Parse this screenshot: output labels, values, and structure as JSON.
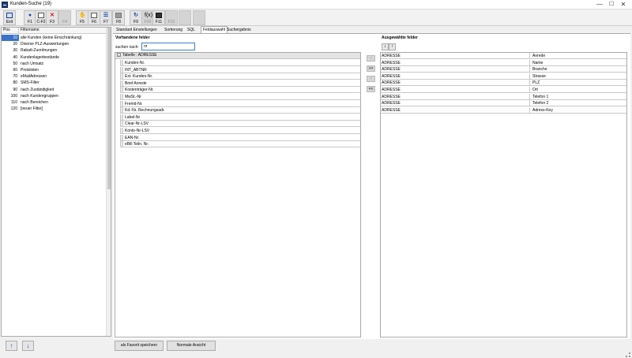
{
  "window": {
    "title": "Kunden-Suche (19)",
    "min_glyph": "—",
    "max_glyph": "☐",
    "close_glyph": "✕"
  },
  "toolbar": [
    {
      "label": "Exit",
      "icon": "exit-door-icon",
      "glyph": "",
      "style": "box",
      "enabled": true
    },
    {
      "label": "F1",
      "icon": "help-icon",
      "glyph": "●",
      "style": "blue",
      "enabled": true
    },
    {
      "label": "C-F2",
      "icon": "new-document-icon",
      "glyph": "",
      "style": "doc",
      "enabled": true
    },
    {
      "label": "F3",
      "icon": "delete-icon",
      "glyph": "✕",
      "style": "red",
      "enabled": true
    },
    {
      "label": "F4",
      "icon": "disabled-icon",
      "glyph": "",
      "style": "",
      "enabled": false
    },
    {
      "label": "F5",
      "icon": "hand-icon",
      "glyph": "✋",
      "style": "",
      "enabled": true
    },
    {
      "label": "F6",
      "icon": "copy-icon",
      "glyph": "",
      "style": "doc",
      "enabled": true
    },
    {
      "label": "F7",
      "icon": "list-icon",
      "glyph": "☰",
      "style": "blue",
      "enabled": true
    },
    {
      "label": "F8",
      "icon": "print-icon",
      "glyph": "",
      "style": "grey",
      "enabled": true
    },
    {
      "label": "F9",
      "icon": "refresh-icon",
      "glyph": "↻",
      "style": "blue",
      "enabled": true
    },
    {
      "label": "F10",
      "icon": "function-icon",
      "glyph": "f(x)",
      "style": "",
      "enabled": false
    },
    {
      "label": "F11",
      "icon": "film-icon",
      "glyph": "",
      "style": "dark",
      "enabled": true
    },
    {
      "label": "F12",
      "icon": "disabled-icon",
      "glyph": "",
      "style": "",
      "enabled": false
    },
    {
      "label": "",
      "icon": "blank-icon",
      "glyph": "",
      "style": "",
      "enabled": false
    },
    {
      "label": "",
      "icon": "blank-icon",
      "glyph": "",
      "style": "",
      "enabled": false
    }
  ],
  "filters": {
    "header": {
      "pos": "Pos",
      "name": "Filtername"
    },
    "rows": [
      {
        "pos": "10",
        "name": "alle Kunden (keine Einschränkung)"
      },
      {
        "pos": "20",
        "name": "Diverse PLZ-Auswertungen"
      },
      {
        "pos": "30",
        "name": "Rabatt-Zuordnungen"
      },
      {
        "pos": "40",
        "name": "Kundenlagerbestände"
      },
      {
        "pos": "50",
        "name": "nach Umsatz"
      },
      {
        "pos": "60",
        "name": "Preislisten"
      },
      {
        "pos": "70",
        "name": "eMailAdressen"
      },
      {
        "pos": "80",
        "name": "SMS-Filter"
      },
      {
        "pos": "90",
        "name": "nach Zuständigkeit"
      },
      {
        "pos": "100",
        "name": "nach Kundengruppen"
      },
      {
        "pos": "110",
        "name": "nach Bereichen"
      },
      {
        "pos": "120",
        "name": "[neuer Filter]"
      }
    ],
    "up_glyph": "↑",
    "down_glyph": "↓"
  },
  "tabs": [
    "Standard Einstellungen",
    "Sortierung",
    "SQL",
    "Feldauswahl",
    "Suchergebnis"
  ],
  "active_tab": 3,
  "available": {
    "title": "Vorhandene felder",
    "search_label": "suchen nach:",
    "search_value": "nr",
    "group_label": "Tabelle : ADRESSE",
    "group_toggle": "-",
    "fields": [
      "Kunden-Nr.",
      "INT_ABTNR",
      "Ext. Kunden-Nr.",
      "Brief Anrede",
      "Kostenträger-Nr.",
      "MwSt.-Nr",
      "Fremd-Nr.",
      "Kd.-Nr. Rechnungsadr.",
      "Label-Nr",
      "Clear-Nr-LSV",
      "Konto-Nr-LSV",
      "EAN-Nr.",
      "eBill Teiln. Nr."
    ]
  },
  "move_buttons": [
    ">",
    ">>",
    "<",
    "<<"
  ],
  "selected": {
    "title": "Ausgewählte felder",
    "order_down": "↓",
    "order_up": "↑",
    "rows": [
      {
        "table": "ADRESSE",
        "field": "Anrede"
      },
      {
        "table": "ADRESSE",
        "field": "Name"
      },
      {
        "table": "ADRESSE",
        "field": "Branche"
      },
      {
        "table": "ADRESSE",
        "field": "Strasse"
      },
      {
        "table": "ADRESSE",
        "field": "PLZ"
      },
      {
        "table": "ADRESSE",
        "field": "Ort"
      },
      {
        "table": "ADRESSE",
        "field": "Telefon 1"
      },
      {
        "table": "ADRESSE",
        "field": "Telefon 2"
      },
      {
        "table": "ADRESSE",
        "field": "Adress-Key"
      }
    ]
  },
  "buttons": {
    "save_favorite": "als Favorit speichern",
    "normal_view": "Normale Ansicht"
  }
}
